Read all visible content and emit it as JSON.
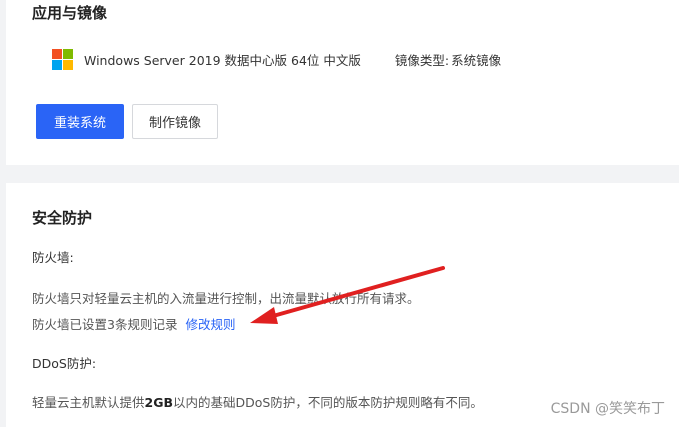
{
  "app_section": {
    "title": "应用与镜像",
    "os_name": "Windows Server 2019 数据中心版 64位 中文版",
    "image_type_label": "镜像类型:",
    "image_type_value": "系统镜像",
    "reinstall_button": "重装系统",
    "make_image_button": "制作镜像",
    "logo_colors": [
      "#f25022",
      "#7fba00",
      "#00a4ef",
      "#ffb900"
    ]
  },
  "security_section": {
    "title": "安全防护",
    "firewall_label": "防火墙:",
    "firewall_desc": "防火墙只对轻量云主机的入流量进行控制，出流量默认放行所有请求。",
    "firewall_rules_text": "防火墙已设置3条规则记录",
    "modify_rules_link": "修改规则",
    "ddos_label": "DDoS防护:",
    "ddos_desc_pre": "轻量云主机默认提供",
    "ddos_desc_strong": "2GB",
    "ddos_desc_post": "以内的基础DDoS防护，不同的版本防护规则略有不同。"
  },
  "watermark": "CSDN @笑笑布丁",
  "colors": {
    "primary": "#2a64f6",
    "arrow": "#e02020",
    "background": "#f2f3f5"
  }
}
